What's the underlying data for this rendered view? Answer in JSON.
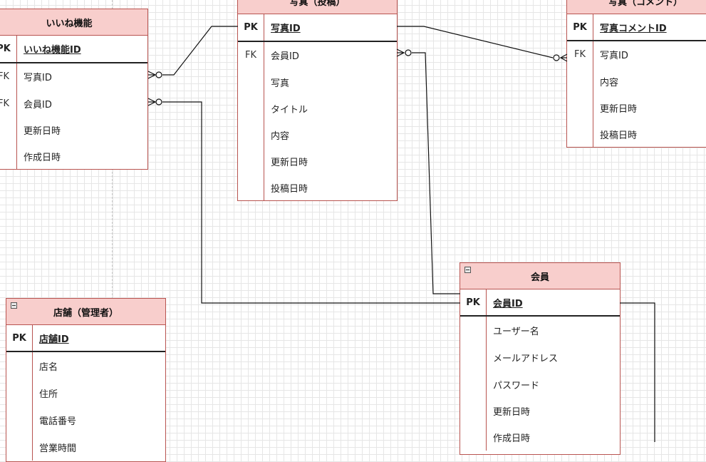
{
  "diagram": {
    "entities": [
      {
        "id": "likes",
        "title": "いいね機能",
        "collapse": false,
        "rows": [
          {
            "key": "PK",
            "name": "いいね機能ID",
            "kind": "pk"
          },
          {
            "key": "FK",
            "name": "写真ID",
            "kind": "fk"
          },
          {
            "key": "FK",
            "name": "会員ID",
            "kind": "fk"
          },
          {
            "key": "",
            "name": "更新日時",
            "kind": "attr"
          },
          {
            "key": "",
            "name": "作成日時",
            "kind": "attr"
          }
        ]
      },
      {
        "id": "photo",
        "title": "写真（投稿）",
        "collapse": false,
        "rows": [
          {
            "key": "PK",
            "name": "写真ID",
            "kind": "pk"
          },
          {
            "key": "FK",
            "name": "会員ID",
            "kind": "fk"
          },
          {
            "key": "",
            "name": "写真",
            "kind": "attr"
          },
          {
            "key": "",
            "name": "タイトル",
            "kind": "attr"
          },
          {
            "key": "",
            "name": "内容",
            "kind": "attr"
          },
          {
            "key": "",
            "name": "更新日時",
            "kind": "attr"
          },
          {
            "key": "",
            "name": "投稿日時",
            "kind": "attr"
          }
        ]
      },
      {
        "id": "comment",
        "title": "写真（コメント）",
        "collapse": false,
        "rows": [
          {
            "key": "PK",
            "name": "写真コメントID",
            "kind": "pk"
          },
          {
            "key": "FK",
            "name": "写真ID",
            "kind": "fk"
          },
          {
            "key": "",
            "name": "内容",
            "kind": "attr"
          },
          {
            "key": "",
            "name": "更新日時",
            "kind": "attr"
          },
          {
            "key": "",
            "name": "投稿日時",
            "kind": "attr"
          }
        ]
      },
      {
        "id": "member",
        "title": "会員",
        "collapse": true,
        "rows": [
          {
            "key": "PK",
            "name": "会員ID",
            "kind": "pk"
          },
          {
            "key": "",
            "name": "ユーザー名",
            "kind": "attr"
          },
          {
            "key": "",
            "name": "メールアドレス",
            "kind": "attr"
          },
          {
            "key": "",
            "name": "パスワード",
            "kind": "attr"
          },
          {
            "key": "",
            "name": "更新日時",
            "kind": "attr"
          },
          {
            "key": "",
            "name": "作成日時",
            "kind": "attr"
          }
        ]
      },
      {
        "id": "store",
        "title": "店舗（管理者）",
        "collapse": true,
        "rows": [
          {
            "key": "PK",
            "name": "店舗ID",
            "kind": "pk"
          },
          {
            "key": "",
            "name": "店名",
            "kind": "attr"
          },
          {
            "key": "",
            "name": "住所",
            "kind": "attr"
          },
          {
            "key": "",
            "name": "電話番号",
            "kind": "attr"
          },
          {
            "key": "",
            "name": "営業時間",
            "kind": "attr"
          }
        ]
      }
    ],
    "relationships": [
      {
        "from": "likes.写真ID",
        "to": "photo.写真ID",
        "from_end": "zero-or-many"
      },
      {
        "from": "likes.会員ID",
        "to": "member.会員ID",
        "from_end": "zero-or-many"
      },
      {
        "from": "photo.会員ID",
        "to": "member.会員ID",
        "from_end": "zero-or-many"
      },
      {
        "from": "comment.写真ID",
        "to": "photo.写真ID",
        "from_end": "zero-or-many"
      },
      {
        "from": "member.会員ID",
        "to": "offscreen",
        "from_end": "one"
      }
    ]
  }
}
